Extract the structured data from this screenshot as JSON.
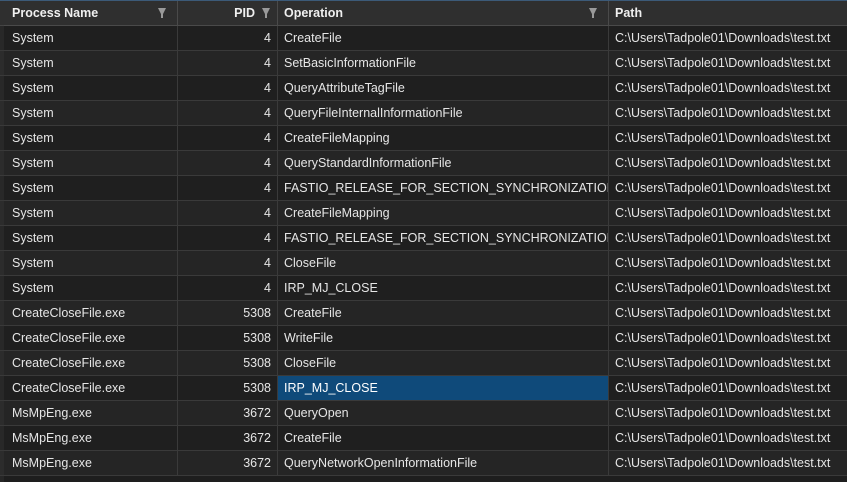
{
  "columns": {
    "process_name": "Process Name",
    "pid": "PID",
    "operation": "Operation",
    "path": "Path"
  },
  "selected_row": 14,
  "rows": [
    {
      "process": "System",
      "pid": "4",
      "operation": "CreateFile",
      "path": "C:\\Users\\Tadpole01\\Downloads\\test.txt"
    },
    {
      "process": "System",
      "pid": "4",
      "operation": "SetBasicInformationFile",
      "path": "C:\\Users\\Tadpole01\\Downloads\\test.txt"
    },
    {
      "process": "System",
      "pid": "4",
      "operation": "QueryAttributeTagFile",
      "path": "C:\\Users\\Tadpole01\\Downloads\\test.txt"
    },
    {
      "process": "System",
      "pid": "4",
      "operation": "QueryFileInternalInformationFile",
      "path": "C:\\Users\\Tadpole01\\Downloads\\test.txt"
    },
    {
      "process": "System",
      "pid": "4",
      "operation": "CreateFileMapping",
      "path": "C:\\Users\\Tadpole01\\Downloads\\test.txt"
    },
    {
      "process": "System",
      "pid": "4",
      "operation": "QueryStandardInformationFile",
      "path": "C:\\Users\\Tadpole01\\Downloads\\test.txt"
    },
    {
      "process": "System",
      "pid": "4",
      "operation": "FASTIO_RELEASE_FOR_SECTION_SYNCHRONIZATION",
      "path": "C:\\Users\\Tadpole01\\Downloads\\test.txt"
    },
    {
      "process": "System",
      "pid": "4",
      "operation": "CreateFileMapping",
      "path": "C:\\Users\\Tadpole01\\Downloads\\test.txt"
    },
    {
      "process": "System",
      "pid": "4",
      "operation": "FASTIO_RELEASE_FOR_SECTION_SYNCHRONIZATION",
      "path": "C:\\Users\\Tadpole01\\Downloads\\test.txt"
    },
    {
      "process": "System",
      "pid": "4",
      "operation": "CloseFile",
      "path": "C:\\Users\\Tadpole01\\Downloads\\test.txt"
    },
    {
      "process": "System",
      "pid": "4",
      "operation": "IRP_MJ_CLOSE",
      "path": "C:\\Users\\Tadpole01\\Downloads\\test.txt"
    },
    {
      "process": "CreateCloseFile.exe",
      "pid": "5308",
      "operation": "CreateFile",
      "path": "C:\\Users\\Tadpole01\\Downloads\\test.txt"
    },
    {
      "process": "CreateCloseFile.exe",
      "pid": "5308",
      "operation": "WriteFile",
      "path": "C:\\Users\\Tadpole01\\Downloads\\test.txt"
    },
    {
      "process": "CreateCloseFile.exe",
      "pid": "5308",
      "operation": "CloseFile",
      "path": "C:\\Users\\Tadpole01\\Downloads\\test.txt"
    },
    {
      "process": "CreateCloseFile.exe",
      "pid": "5308",
      "operation": "IRP_MJ_CLOSE",
      "path": "C:\\Users\\Tadpole01\\Downloads\\test.txt"
    },
    {
      "process": "MsMpEng.exe",
      "pid": "3672",
      "operation": "QueryOpen",
      "path": "C:\\Users\\Tadpole01\\Downloads\\test.txt"
    },
    {
      "process": "MsMpEng.exe",
      "pid": "3672",
      "operation": "CreateFile",
      "path": "C:\\Users\\Tadpole01\\Downloads\\test.txt"
    },
    {
      "process": "MsMpEng.exe",
      "pid": "3672",
      "operation": "QueryNetworkOpenInformationFile",
      "path": "C:\\Users\\Tadpole01\\Downloads\\test.txt"
    }
  ]
}
